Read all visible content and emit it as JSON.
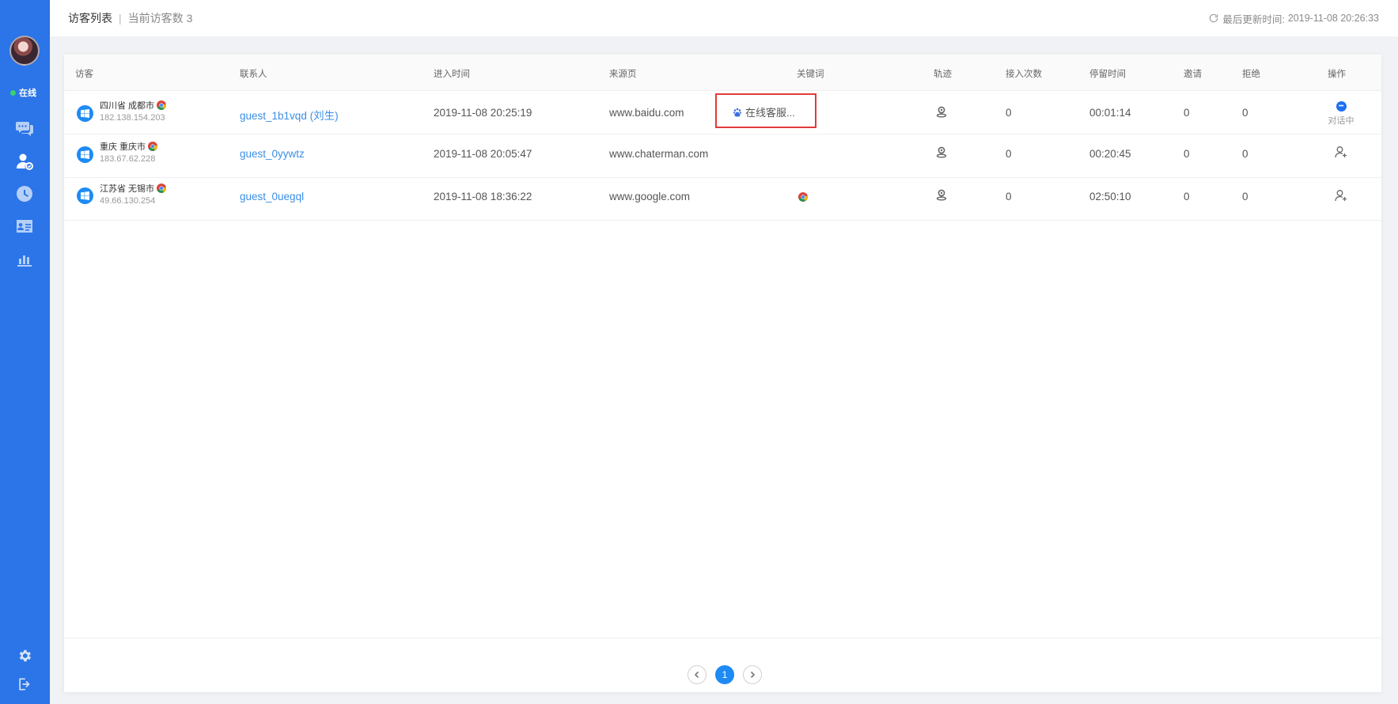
{
  "sidebar": {
    "status_label": "在线",
    "nav": [
      "chat-icon",
      "visitor-icon",
      "history-icon",
      "contacts-icon",
      "stats-icon"
    ],
    "bottom": [
      "settings-icon",
      "logout-icon"
    ],
    "accent": "#2b75e8"
  },
  "header": {
    "title": "访客列表",
    "separator": "|",
    "subtitle": "当前访客数",
    "count": "3",
    "updated_label": "最后更新时间:",
    "updated_time": "2019-11-08 20:26:33"
  },
  "table": {
    "columns": [
      "访客",
      "联系人",
      "进入时间",
      "来源页",
      "关键词",
      "轨迹",
      "接入次数",
      "停留时间",
      "邀请",
      "拒绝",
      "操作"
    ],
    "rows": [
      {
        "location": "四川省 成都市",
        "ip": "182.138.154.203",
        "contact": "guest_1b1vqd  (刘生)",
        "enter_time": "2019-11-08 20:25:19",
        "source": "www.baidu.com",
        "keyword": "在线客服...",
        "keyword_engine": "baidu-paw-icon",
        "visits": "0",
        "stay": "00:01:14",
        "invite": "0",
        "reject": "0",
        "action": "对话中"
      },
      {
        "location": "重庆 重庆市",
        "ip": "183.67.62.228",
        "contact": "guest_0yywtz",
        "enter_time": "2019-11-08 20:05:47",
        "source": "www.chaterman.com",
        "keyword": "",
        "visits": "0",
        "stay": "00:20:45",
        "invite": "0",
        "reject": "0",
        "action": "invite-user-icon"
      },
      {
        "location": "江苏省 无锡市",
        "ip": "49.66.130.254",
        "contact": "guest_0uegql",
        "enter_time": "2019-11-08 18:36:22",
        "source": "www.google.com",
        "keyword": "",
        "keyword_engine": "google-chrome-icon",
        "visits": "0",
        "stay": "02:50:10",
        "invite": "0",
        "reject": "0",
        "action": "invite-user-icon"
      }
    ]
  },
  "pagination": {
    "current_page": "1"
  }
}
